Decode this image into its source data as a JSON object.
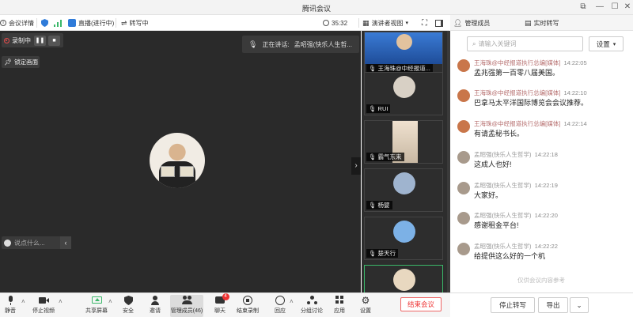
{
  "window": {
    "title": "腾讯会议"
  },
  "toolbar": {
    "meeting_info": "会议详情",
    "live": "直播(进行中)",
    "transcribing": "转写中",
    "timer": "35:32",
    "speaker_view": "演讲者视图"
  },
  "video": {
    "recording_label": "录制中",
    "lock_view": "锁定画面",
    "speaking_prefix": "正在讲话:",
    "speaking_name": "孟昭强(快乐人生哲...",
    "chat_placeholder": "说点什么..."
  },
  "gallery": {
    "tiles": [
      {
        "name": "王海珠@中经报道..."
      },
      {
        "name": "RUI"
      },
      {
        "name": "霸气东来"
      },
      {
        "name": "杨婴"
      },
      {
        "name": "楚天行"
      },
      {
        "name": ""
      }
    ]
  },
  "panel": {
    "tab_members": "管理成员",
    "tab_transcript": "实时转写",
    "search_placeholder": "请输入关键词",
    "settings_label": "设置",
    "watermark": "仅供会议内容参考",
    "stop_transcribe": "停止转写",
    "export": "导出"
  },
  "messages": [
    {
      "name": "王海珠@中经报道执行总编[媒体]",
      "time": "14:22:05",
      "text": "孟兆强第一百零八届美国。",
      "kind": "a"
    },
    {
      "name": "王海珠@中经报道执行总编[媒体]",
      "time": "14:22:10",
      "text": "巴拿马太平洋国际博览会会议推荐。",
      "kind": "a"
    },
    {
      "name": "王海珠@中经报道执行总编[媒体]",
      "time": "14:22:14",
      "text": "有请孟秘书长。",
      "kind": "a"
    },
    {
      "name": "孟昭强(快乐人生哲学)",
      "time": "14:22:18",
      "text": "这成人也好!",
      "kind": "b"
    },
    {
      "name": "孟昭强(快乐人生哲学)",
      "time": "14:22:19",
      "text": "大家好。",
      "kind": "b"
    },
    {
      "name": "孟昭强(快乐人生哲学)",
      "time": "14:22:20",
      "text": "感谢租金平台!",
      "kind": "b"
    },
    {
      "name": "孟昭强(快乐人生哲学)",
      "time": "14:22:22",
      "text": "给提供这么好的一个机",
      "kind": "b"
    }
  ],
  "bottom": {
    "mute": "静音",
    "stop_video": "停止视频",
    "share": "共享屏幕",
    "security": "安全",
    "invite": "邀请",
    "members": "管理成员(46)",
    "chat": "聊天",
    "chat_badge": "4",
    "end_record": "结束录制",
    "reactions": "回应",
    "breakout": "分组讨论",
    "apps": "应用",
    "settings": "设置",
    "end_meeting": "结束会议"
  },
  "colors": {
    "accent_green": "#3bb86a",
    "end_red": "#e33333",
    "record_red": "#e34a4a",
    "shield_blue": "#2f7bd9"
  }
}
